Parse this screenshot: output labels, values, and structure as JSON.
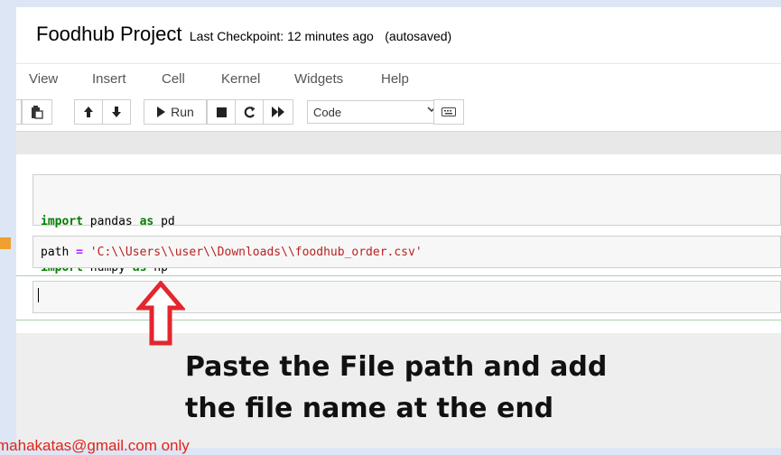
{
  "notebook": {
    "name": "Foodhub Project",
    "checkpoint": "Last Checkpoint: 12 minutes ago",
    "autosave": "(autosaved)"
  },
  "menu": [
    "View",
    "Insert",
    "Cell",
    "Kernel",
    "Widgets",
    "Help"
  ],
  "toolbar": {
    "run_label": "Run",
    "cell_type": "Code"
  },
  "cells": [
    {
      "lines": [
        [
          {
            "t": "import",
            "c": "kw"
          },
          {
            "t": " pandas "
          },
          {
            "t": "as",
            "c": "kw"
          },
          {
            "t": " pd"
          }
        ],
        [
          {
            "t": "import",
            "c": "kw"
          },
          {
            "t": " numpy "
          },
          {
            "t": "as",
            "c": "kw"
          },
          {
            "t": " np"
          }
        ]
      ]
    },
    {
      "lines": [
        [
          {
            "t": "path "
          },
          {
            "t": "=",
            "c": "eq"
          },
          {
            "t": " "
          },
          {
            "t": "'C:\\\\Users\\\\user\\\\Downloads\\\\foodhub_order.csv'",
            "c": "str"
          }
        ]
      ]
    },
    {
      "lines": []
    }
  ],
  "annotation": {
    "line1": "Paste the File path and add",
    "line2": "the file name at the end"
  },
  "watermark": "mahakatas@gmail.com only",
  "colors": {
    "keyword": "#008000",
    "string": "#ba2121",
    "arrow": "#e3262e",
    "watermark": "#e0231c"
  }
}
